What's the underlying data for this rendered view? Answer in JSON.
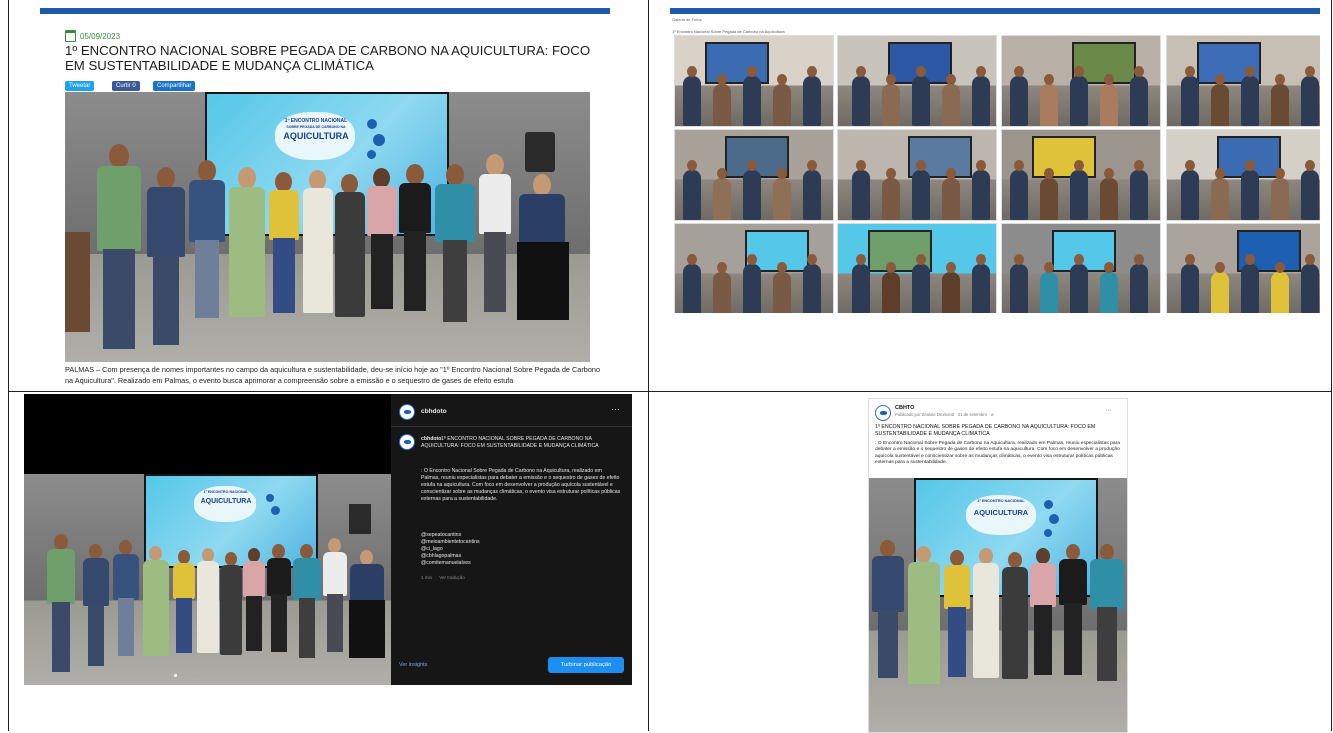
{
  "article": {
    "date": "05/09/2023",
    "headline": "1º ENCONTRO NACIONAL SOBRE PEGADA DE CARBONO NA AQUICULTURA: FOCO EM SUSTENTABILIDADE E MUDANÇA CLIMÁTICA",
    "share_buttons": [
      "Tweetar",
      "Curtir 0",
      "Compartilhar"
    ],
    "body": "PALMAS – Com presença de nomes importantes no campo da aquicultura e sustentabilidade, deu-se início hoje ao \"1º Encontro Nacional Sobre Pegada de Carbono na Aquicultura\". Realizado em Palmas, o evento busca aprimorar a compreensão sobre a emissão e o sequestro de gases de efeito estufa"
  },
  "banner": {
    "line1": "1º ENCONTRO NACIONAL",
    "line2": "SOBRE PEGADA DE CARBONO NA",
    "line3": "AQUICULTURA"
  },
  "gallery": {
    "label": "Galeria de Fotos",
    "caption": "1º Encontro Nacional Sobre Pegada de Carbono na Aquicultura"
  },
  "instagram": {
    "username": "cbhdoto",
    "caption_title": "1º ENCONTRO NACIONAL SOBRE PEGADA DE CARBONO NA AQUICULTURA: FOCO EM SUSTENTABILIDADE E MUDANÇA CLIMÁTICA",
    "caption_body": ": O Encontro Nacional Sobre Pegada de Carbono na Aquicultura, realizado em Palmas, reuniu especialistas para debater a emissão e o sequestro de gases de efeito estufa na aquicultura. Com foco em desenvolver a produção aquícola sustentável e conscientizar sobre as mudanças climáticas, o evento visa estruturar políticas públicas externas para a sustentabilidade.",
    "mentions": [
      "@sepeatocantins",
      "@meioambientetocantins",
      "@ci_lago",
      "@cbhlagopalmas",
      "@comitemanuelalves"
    ],
    "time": "1 min",
    "translate": "Ver tradução",
    "insights": "Ver insights",
    "boost": "Turbinar publicação",
    "more_icon": "…"
  },
  "facebook": {
    "page_name": "CBHTO",
    "meta": "Publicado por Zealote Drumond · 21 de setembro · ⊘",
    "title": "1º ENCONTRO NACIONAL SOBRE PEGADA DE CARBONO NA AQUICULTURA: FOCO EM SUSTENTABILIDADE E MUDANÇA CLIMÁTICA",
    "text": ": O Encontro Nacional Sobre Pegada de Carbono na Aquicultura, realizado em Palmas, reuniu especialistas para debater a emissão e o sequestro de gases de efeito estufa na aquicultura. Com foco em desenvolver a produção aquícola sustentável e conscientizar sobre as mudanças climáticas, o evento visa estruturar políticas públicas externas para a sustentabilidade.",
    "more_icon": "···"
  },
  "colors": {
    "accent_blue": "#1f5aa8",
    "share_twitter": "#1da1f2",
    "share_fb": "#3b5998",
    "ig_button": "#1d8ff2"
  }
}
